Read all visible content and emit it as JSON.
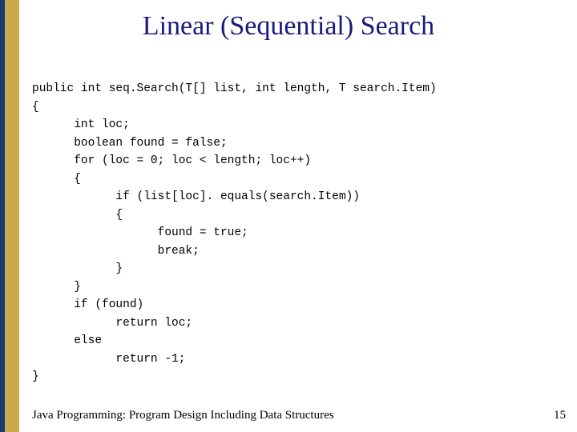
{
  "slide": {
    "title": "Linear (Sequential) Search",
    "footer": "Java Programming: Program Design Including Data Structures",
    "page": "15"
  },
  "code": {
    "line01": "public int seq.Search(T[] list, int length, T search.Item)",
    "line02": "{",
    "line03": "      int loc;",
    "line04": "      boolean found = false;",
    "line05": "      for (loc = 0; loc < length; loc++)",
    "line06": "      {",
    "line07": "            if (list[loc]. equals(search.Item))",
    "line08": "            {",
    "line09": "                  found = true;",
    "line10": "                  break;",
    "line11": "            }",
    "line12": "      }",
    "line13": "      if (found)",
    "line14": "            return loc;",
    "line15": "      else",
    "line16": "            return -1;",
    "line17": "}"
  }
}
